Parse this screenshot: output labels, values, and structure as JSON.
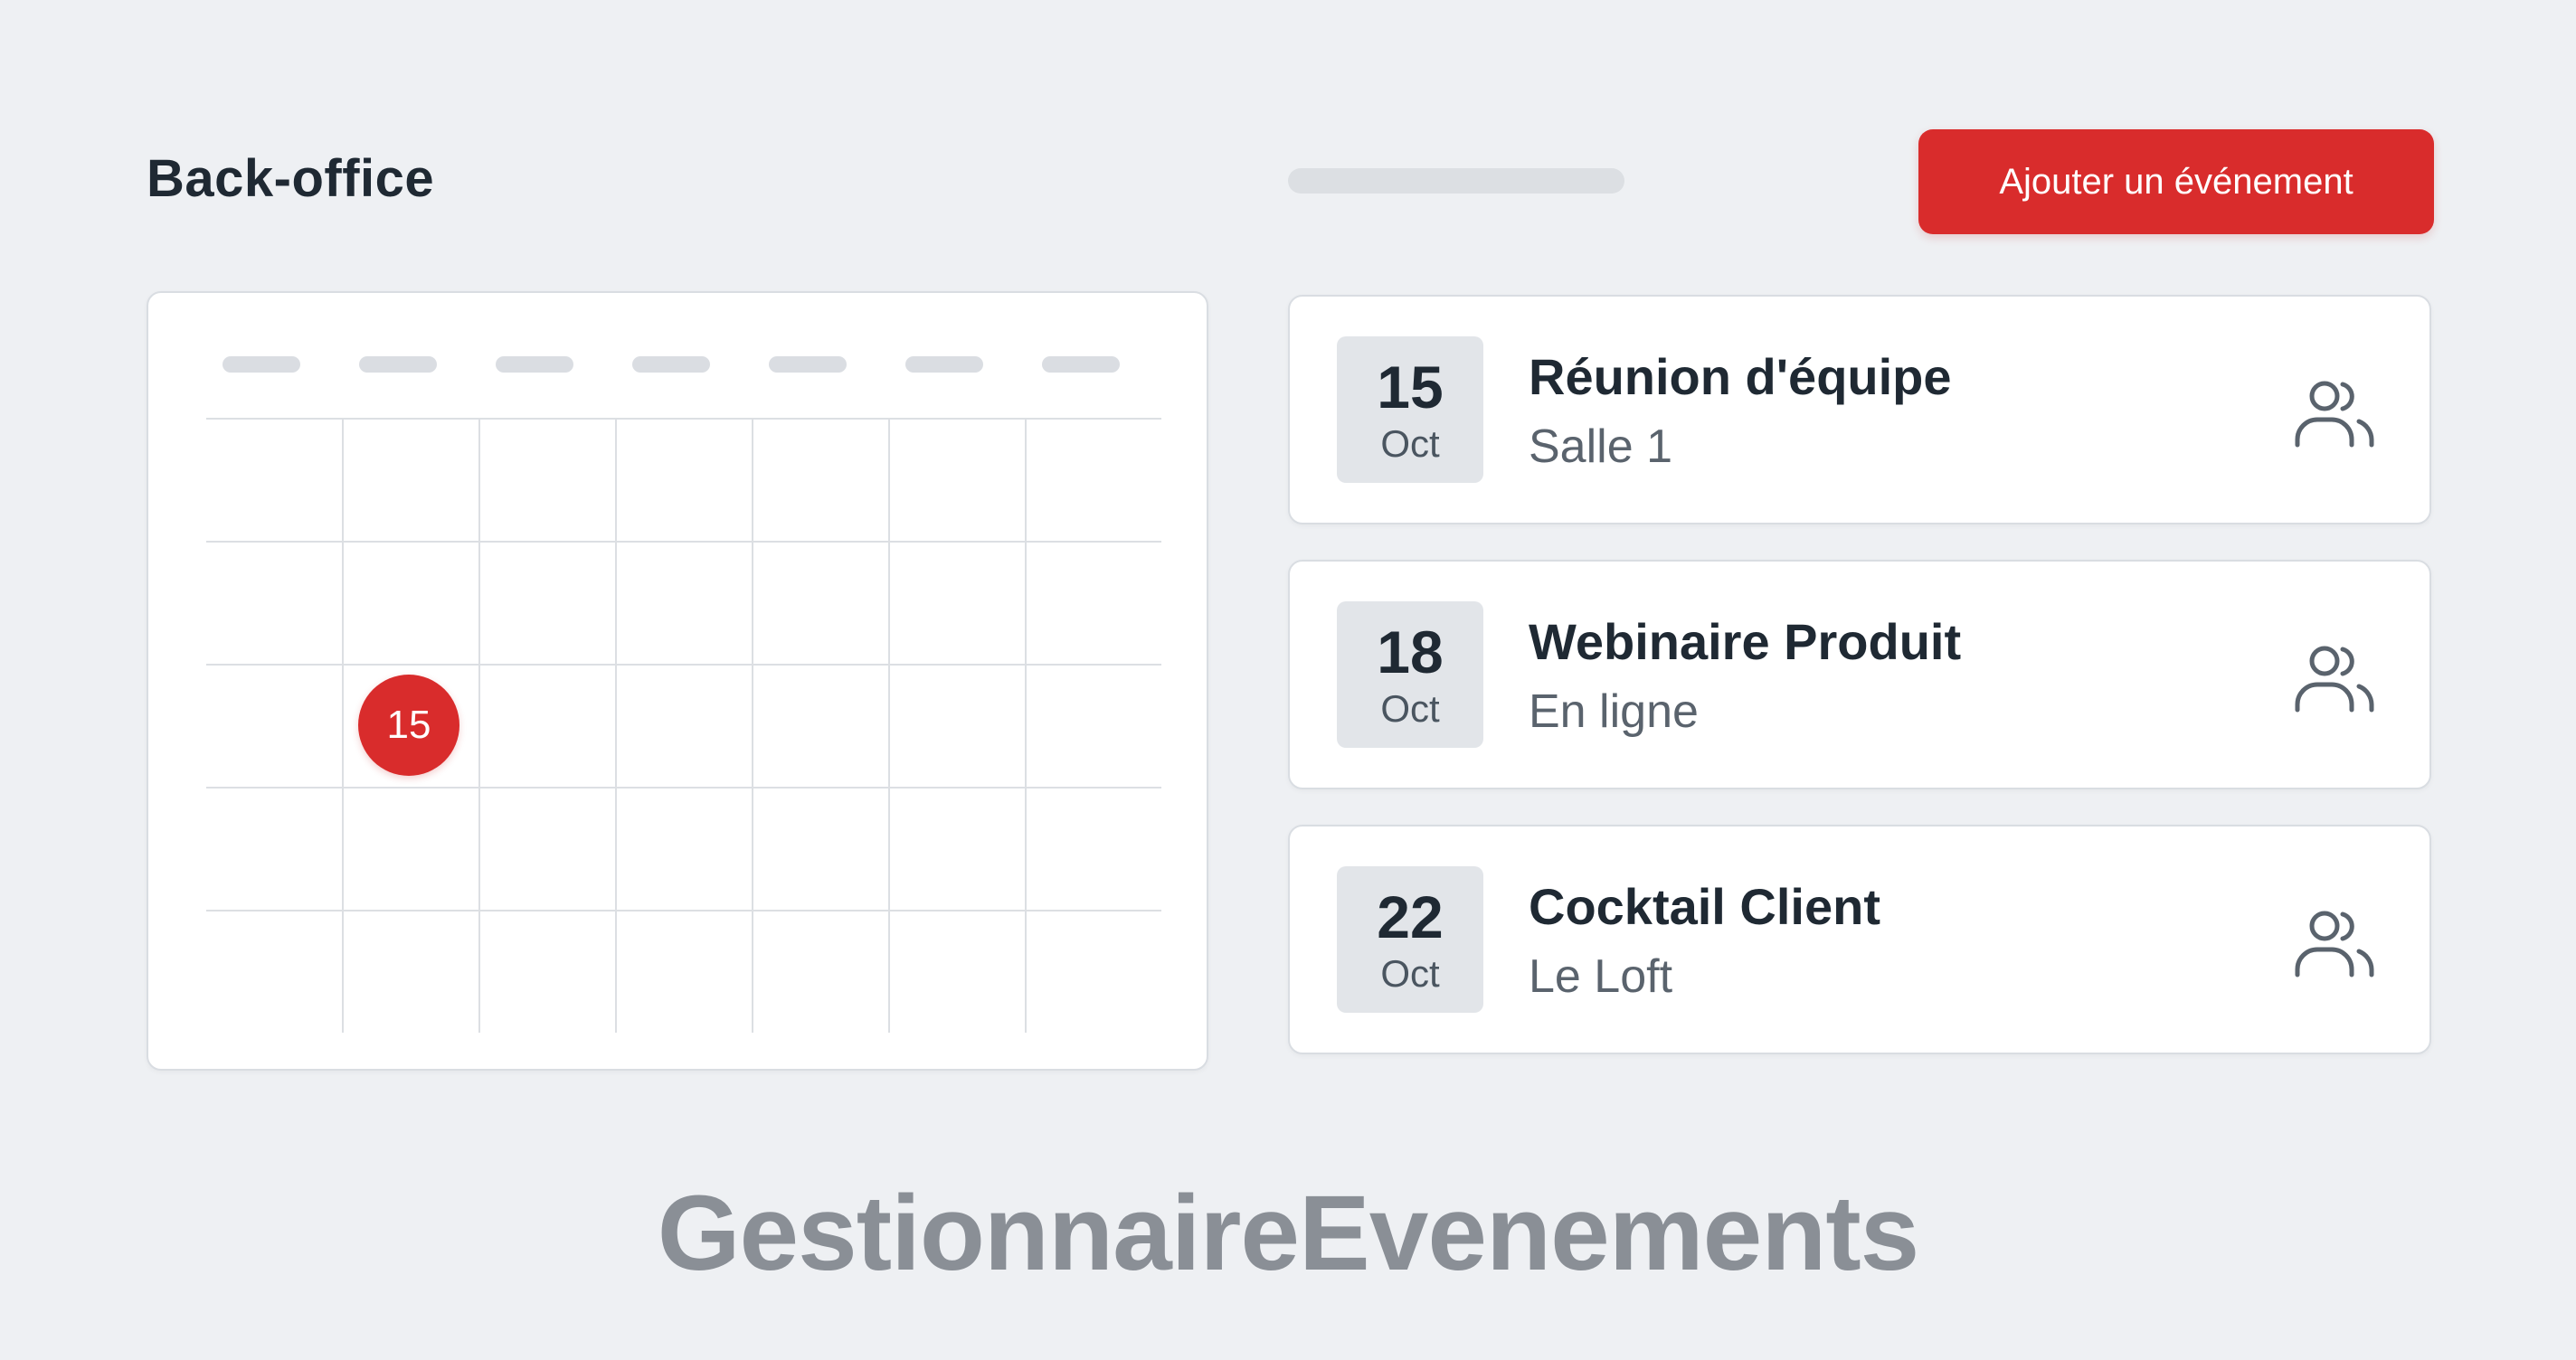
{
  "header": {
    "title": "Back-office",
    "add_button_label": "Ajouter un événement"
  },
  "calendar": {
    "selected_day": "15"
  },
  "events": [
    {
      "day": "15",
      "month": "Oct",
      "title": "Réunion d'équipe",
      "location": "Salle 1",
      "icon": "users-icon"
    },
    {
      "day": "18",
      "month": "Oct",
      "title": "Webinaire Produit",
      "location": "En ligne",
      "icon": "users-icon"
    },
    {
      "day": "22",
      "month": "Oct",
      "title": "Cocktail Client",
      "location": "Le Loft",
      "icon": "users-icon"
    }
  ],
  "footer": {
    "brand": "GestionnaireEvenements"
  },
  "colors": {
    "accent": "#d92c2c",
    "background": "#eef0f3",
    "text": "#1f2933",
    "muted": "#5a636d"
  }
}
